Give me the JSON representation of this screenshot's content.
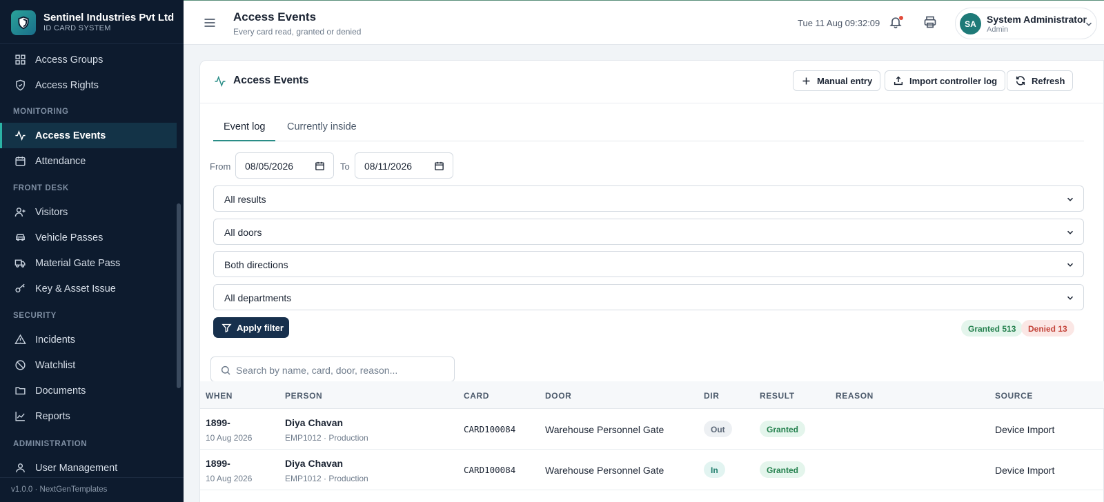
{
  "brand": {
    "name": "Sentinel Industries Pvt Ltd",
    "subtitle": "ID CARD SYSTEM"
  },
  "sidebar": {
    "items": [
      {
        "label": "Access Groups",
        "icon": "grid-icon"
      },
      {
        "label": "Access Rights",
        "icon": "shield-icon"
      },
      {
        "label": "Access Events",
        "icon": "activity-icon",
        "active": true
      },
      {
        "label": "Attendance",
        "icon": "calendar-icon"
      },
      {
        "label": "Visitors",
        "icon": "user-plus-icon"
      },
      {
        "label": "Vehicle Passes",
        "icon": "car-icon"
      },
      {
        "label": "Material Gate Pass",
        "icon": "truck-icon"
      },
      {
        "label": "Key & Asset Issue",
        "icon": "key-icon"
      },
      {
        "label": "Incidents",
        "icon": "alert-triangle-icon"
      },
      {
        "label": "Watchlist",
        "icon": "ban-icon"
      },
      {
        "label": "Documents",
        "icon": "folder-icon"
      },
      {
        "label": "Reports",
        "icon": "chart-icon"
      },
      {
        "label": "User Management",
        "icon": "user-icon"
      }
    ],
    "sections": [
      "MONITORING",
      "FRONT DESK",
      "SECURITY",
      "ADMINISTRATION"
    ],
    "footer": "v1.0.0 · NextGenTemplates"
  },
  "topbar": {
    "title": "Access Events",
    "subtitle": "Every card read, granted or denied",
    "datetime": "Tue 11 Aug 09:32:09",
    "user": {
      "initials": "SA",
      "name": "System Administrator",
      "role": "Admin"
    }
  },
  "card": {
    "title": "Access Events",
    "buttons": {
      "manual": "Manual entry",
      "import": "Import controller log",
      "refresh": "Refresh"
    },
    "tabs": [
      "Event log",
      "Currently inside"
    ],
    "filters": {
      "from_label": "From",
      "from_value": "08/05/2026",
      "to_label": "To",
      "to_value": "08/11/2026",
      "result": "All results",
      "door": "All doors",
      "direction": "Both directions",
      "department": "All departments",
      "apply": "Apply filter"
    },
    "stats": {
      "granted": "Granted 513",
      "denied": "Denied 13"
    },
    "search_placeholder": "Search by name, card, door, reason...",
    "columns": [
      "WHEN",
      "PERSON",
      "CARD",
      "DOOR",
      "DIR",
      "RESULT",
      "REASON",
      "SOURCE"
    ],
    "rows": [
      {
        "when": "1899-",
        "date": "10 Aug 2026",
        "name": "Diya Chavan",
        "meta": "EMP1012 · Production",
        "card": "CARD100084",
        "door": "Warehouse Personnel Gate",
        "dir": "Out",
        "result": "Granted",
        "reason": "",
        "source": "Device Import"
      },
      {
        "when": "1899-",
        "date": "10 Aug 2026",
        "name": "Diya Chavan",
        "meta": "EMP1012 · Production",
        "card": "CARD100084",
        "door": "Warehouse Personnel Gate",
        "dir": "In",
        "result": "Granted",
        "reason": "",
        "source": "Device Import"
      }
    ]
  },
  "colors": {
    "sidebar_bg": "#0d1b2e",
    "accent": "#2a8d87",
    "primary_button": "#17304d",
    "granted": "#23804d",
    "denied": "#c4443a"
  }
}
